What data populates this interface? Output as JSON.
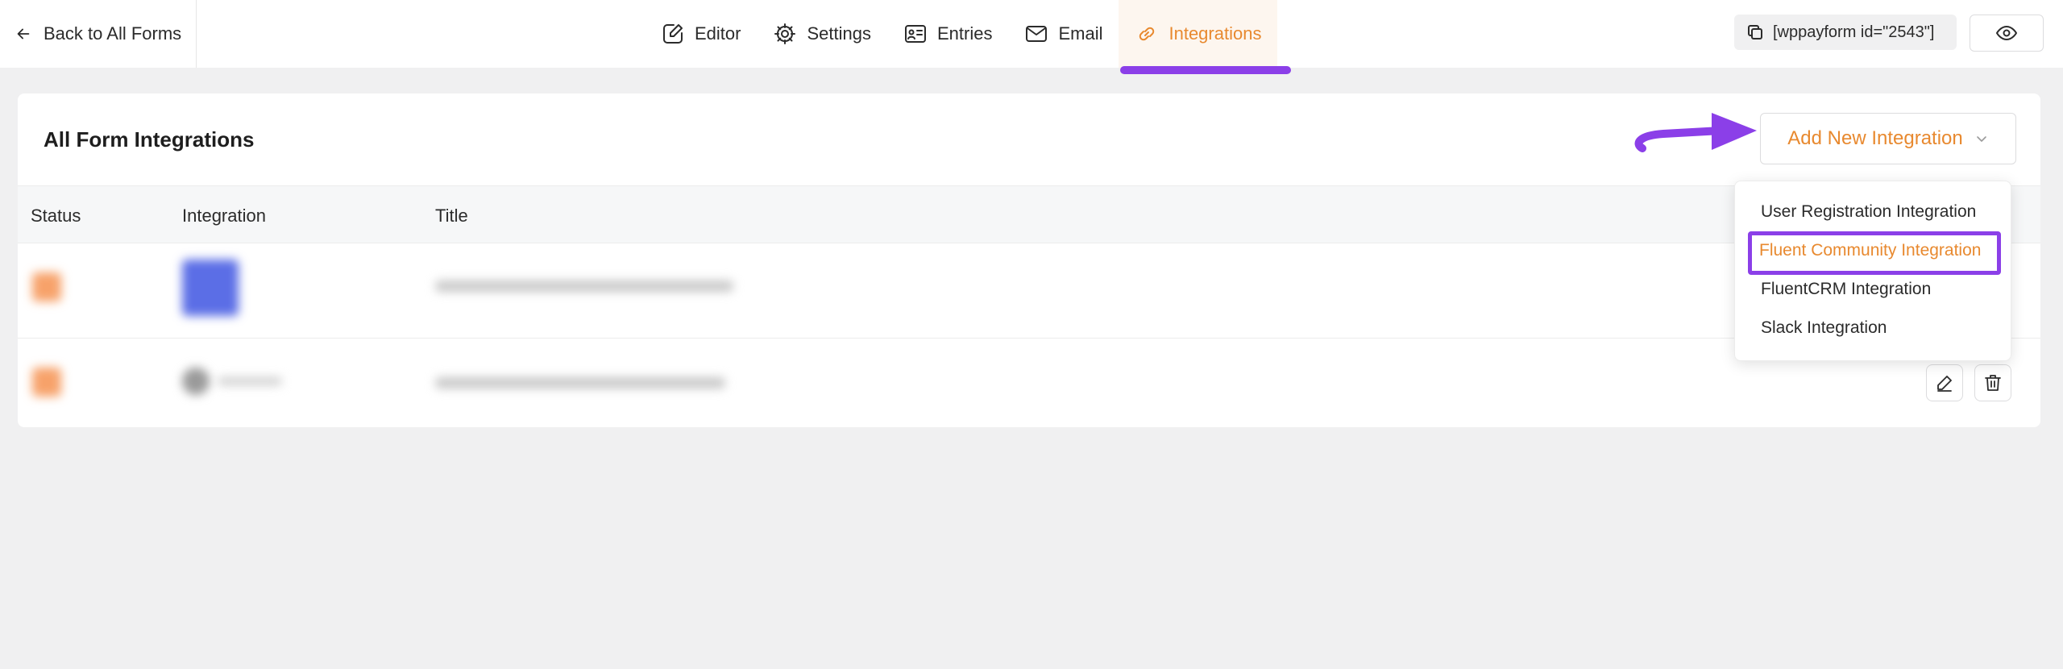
{
  "topbar": {
    "back_label": "Back to All Forms",
    "tabs": [
      {
        "label": "Editor",
        "icon": "editor-icon"
      },
      {
        "label": "Settings",
        "icon": "gear-icon"
      },
      {
        "label": "Entries",
        "icon": "entries-icon"
      },
      {
        "label": "Email",
        "icon": "email-icon"
      },
      {
        "label": "Integrations",
        "icon": "link-icon",
        "active": true
      }
    ],
    "shortcode": "[wppayform id=\"2543\"]"
  },
  "card": {
    "title": "All Form Integrations",
    "add_button_label": "Add New Integration",
    "columns": [
      "Status",
      "Integration",
      "Title"
    ]
  },
  "dropdown": {
    "items": [
      "User Registration Integration",
      "Fluent Community Integration",
      "FluentCRM Integration",
      "Slack Integration"
    ],
    "highlighted_index": 1
  },
  "colors": {
    "accent": "#e8892f",
    "annotation": "#8b3fe8",
    "integration_icon": "#5b6ee6"
  }
}
